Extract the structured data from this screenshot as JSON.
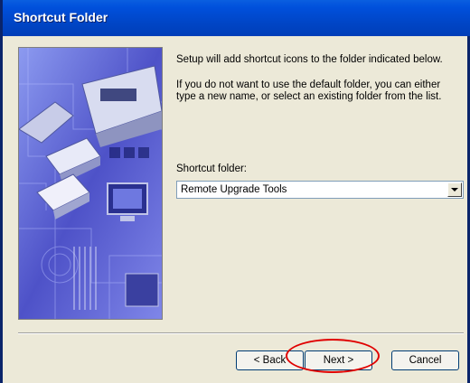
{
  "window": {
    "title": "Shortcut Folder"
  },
  "content": {
    "paragraph1": "Setup will add shortcut icons to the folder indicated below.",
    "paragraph2_line1": "If you do not want to use the default folder, you can either",
    "paragraph2_line2": "type a new name, or select an existing folder from the list.",
    "field_label": "Shortcut folder:",
    "select_value": "Remote Upgrade Tools"
  },
  "buttons": {
    "back": "< Back",
    "next": "Next >",
    "cancel": "Cancel"
  },
  "colors": {
    "titlebar": "#0050DC",
    "dialog_bg": "#ECE9D8",
    "highlight_ring": "#E00000"
  }
}
